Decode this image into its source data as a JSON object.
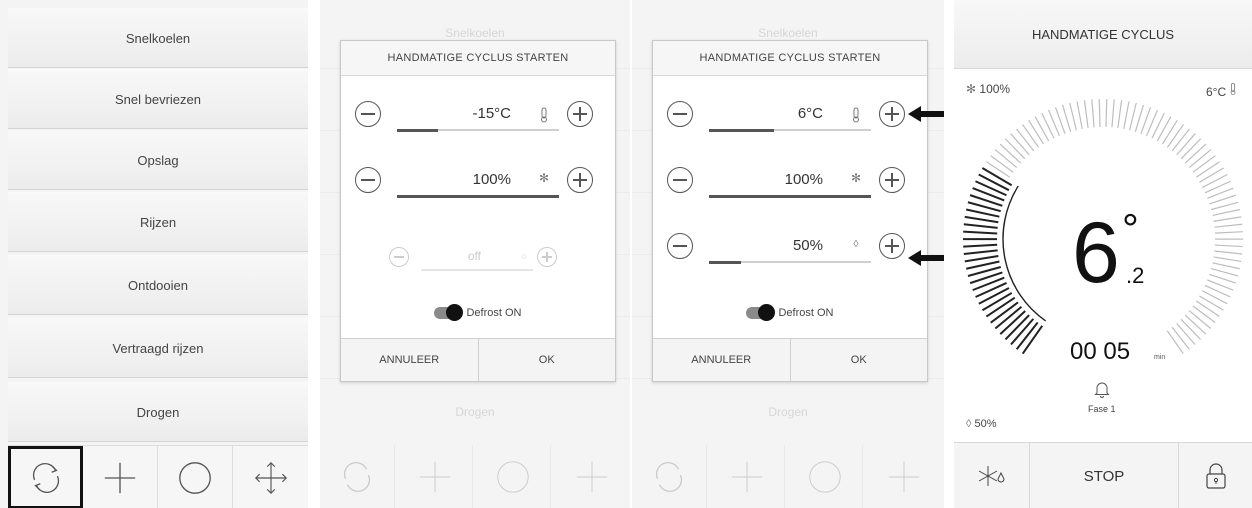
{
  "menu": {
    "items": [
      "Snelkoelen",
      "Snel bevriezen",
      "Opslag",
      "Rijzen",
      "Ontdooien",
      "Vertraagd rijzen",
      "Drogen"
    ],
    "toolbar_icons": [
      "cycle-icon",
      "plus-icon",
      "circle-icon",
      "move-arrows-icon"
    ],
    "selected_toolbar_index": 0
  },
  "dialog_a": {
    "bg_top_label": "Snelkoelen",
    "bg_bottom_label": "Drogen",
    "title": "HANDMATIGE CYCLUS STARTEN",
    "temperature": {
      "value": "-15°C",
      "icon": "thermometer-icon",
      "level": 0.25
    },
    "fan": {
      "value": "100%",
      "icon": "fan-icon",
      "level": 1.0
    },
    "humidity": {
      "value": "off",
      "icon": "drop-icon",
      "level": 0,
      "enabled": false
    },
    "defrost_label": "Defrost ON",
    "cancel_label": "ANNULEER",
    "ok_label": "OK"
  },
  "dialog_b": {
    "bg_top_label": "Snelkoelen",
    "bg_bottom_label": "Drogen",
    "title": "HANDMATIGE CYCLUS STARTEN",
    "temperature": {
      "value": "6°C",
      "icon": "thermometer-icon",
      "level": 0.4
    },
    "fan": {
      "value": "100%",
      "icon": "fan-icon",
      "level": 1.0
    },
    "humidity": {
      "value": "50%",
      "icon": "drop-icon",
      "level": 0.2,
      "enabled": true
    },
    "defrost_label": "Defrost ON",
    "cancel_label": "ANNULEER",
    "ok_label": "OK"
  },
  "cycle": {
    "title": "HANDMATIGE CYCLUS",
    "fan_readout": "100%",
    "temp_readout": "6°C",
    "temp_integer": "6",
    "temp_degree": "°",
    "temp_decimal": ".2",
    "timer": "00 05",
    "timer_unit": "min",
    "phase": "Fase 1",
    "humidity_readout": "50%",
    "stop_label": "STOP",
    "progress": 0.3
  },
  "colors": {
    "arrow": "#111111",
    "toggle_track": "#8a8a8a"
  }
}
